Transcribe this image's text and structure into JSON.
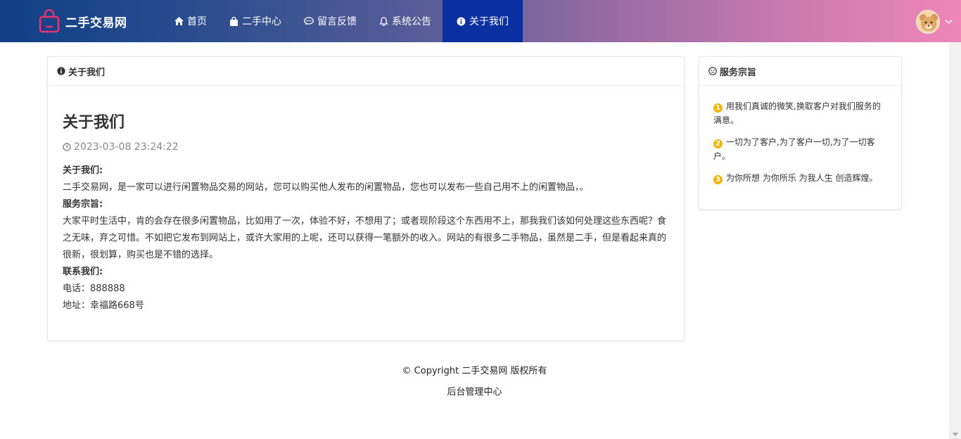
{
  "brand": {
    "name": "二手交易网",
    "icon": "shopping-bag-icon"
  },
  "nav": [
    {
      "label": "首页",
      "icon": "home-icon",
      "active": false
    },
    {
      "label": "二手中心",
      "icon": "bag-icon",
      "active": false
    },
    {
      "label": "留言反馈",
      "icon": "comment-icon",
      "active": false
    },
    {
      "label": "系统公告",
      "icon": "bell-icon",
      "active": false
    },
    {
      "label": "关于我们",
      "icon": "info-icon",
      "active": true
    }
  ],
  "main_card": {
    "header": "关于我们",
    "title": "关于我们",
    "date": "2023-03-08 23:24:22",
    "sections": {
      "about_label": "关于我们:",
      "about_text": "二手交易网，是一家可以进行闲置物品交易的网站，您可以购买他人发布的闲置物品，您也可以发布一些自己用不上的闲置物品，。",
      "purpose_label": "服务宗旨:",
      "purpose_text": "大家平时生活中，肯的会存在很多闲置物品，比如用了一次，体验不好，不想用了；或者现阶段这个东西用不上，那我我们该如何处理这些东西呢？食之无味，弃之可惜。不如把它发布到网站上，或许大家用的上呢，还可以获得一笔额外的收入。网站的有很多二手物品，虽然是二手，但是看起来真的很新，很划算，购买也是不错的选择。",
      "contact_label": "联系我们:",
      "phone": "电话：888888",
      "address": "地址：幸福路668号"
    }
  },
  "side_card": {
    "header": "服务宗旨",
    "items": [
      {
        "num": "1",
        "text": "用我们真诚的微笑,换取客户对我们服务的满意。"
      },
      {
        "num": "2",
        "text": "一切为了客户,为了客户一切,为了一切客户。"
      },
      {
        "num": "3",
        "text": "为你所想 为你所乐 为我人生 创造辉煌。"
      }
    ]
  },
  "footer": {
    "copyright": "© Copyright 二手交易网 版权所有",
    "admin_link": "后台管理中心"
  },
  "colors": {
    "nav_active": "#0a2fa0",
    "accent_number": "#f5b400",
    "brand_icon": "#e8326e"
  }
}
